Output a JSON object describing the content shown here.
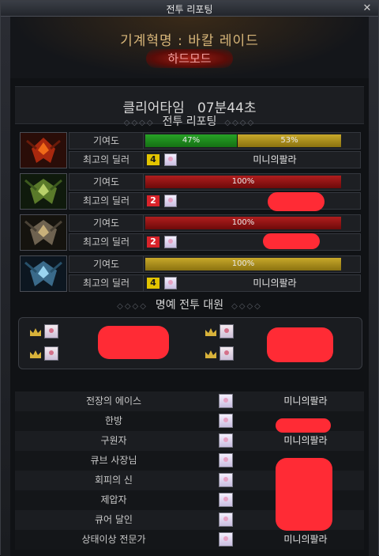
{
  "window": {
    "title": "전투 리포팅",
    "close_glyph": "✕"
  },
  "raid": {
    "title": "기계혁명 : 바칼 레이드",
    "mode": "하드모드"
  },
  "clear": {
    "label": "클리어타임",
    "time": "07분44초"
  },
  "sections": {
    "report": "전투 리포팅",
    "honor": "명예 전투 대원",
    "ornament": "◇◇◇◇"
  },
  "colors": {
    "green": "#27a226",
    "yellow": "#c8a82a",
    "red": "#b11e1e",
    "redaction": "#ff2b35"
  },
  "bosses": [
    {
      "icon": "red-dragon-boss-icon",
      "contribution_label": "기여도",
      "dealer_label": "최고의 딜러",
      "segments": [
        {
          "text": "47%",
          "value": 47,
          "color": "green"
        },
        {
          "text": "53%",
          "value": 53,
          "color": "yellow"
        }
      ],
      "dealer_rank": "4",
      "dealer_name": "미니의팔라"
    },
    {
      "icon": "green-dragon-boss-icon",
      "contribution_label": "기여도",
      "dealer_label": "최고의 딜러",
      "segments": [
        {
          "text": "100%",
          "value": 100,
          "color": "red"
        }
      ],
      "dealer_rank": "2",
      "dealer_name": ""
    },
    {
      "icon": "dark-dragon-boss-icon",
      "contribution_label": "기여도",
      "dealer_label": "최고의 딜러",
      "segments": [
        {
          "text": "100%",
          "value": 100,
          "color": "red"
        }
      ],
      "dealer_rank": "2",
      "dealer_name": ""
    },
    {
      "icon": "blue-dragon-boss-icon",
      "contribution_label": "기여도",
      "dealer_label": "최고의 딜러",
      "segments": [
        {
          "text": "100%",
          "value": 100,
          "color": "yellow"
        }
      ],
      "dealer_rank": "4",
      "dealer_name": "미니의팔라"
    }
  ],
  "honor_members": [
    {
      "icon": "crown-icon",
      "name": ""
    },
    {
      "icon": "crown-icon",
      "name": ""
    },
    {
      "icon": "crown-icon",
      "name": ""
    },
    {
      "icon": "crown-icon",
      "name": ""
    }
  ],
  "awards": [
    {
      "title": "전장의 에이스",
      "player": "미니의팔라"
    },
    {
      "title": "한방",
      "player": ""
    },
    {
      "title": "구원자",
      "player": "미니의팔라"
    },
    {
      "title": "큐브 사장님",
      "player": ""
    },
    {
      "title": "회피의 신",
      "player": ""
    },
    {
      "title": "제압자",
      "player": ""
    },
    {
      "title": "큐어 달인",
      "player": ""
    },
    {
      "title": "상태이상 전문가",
      "player": "미니의팔라"
    }
  ]
}
